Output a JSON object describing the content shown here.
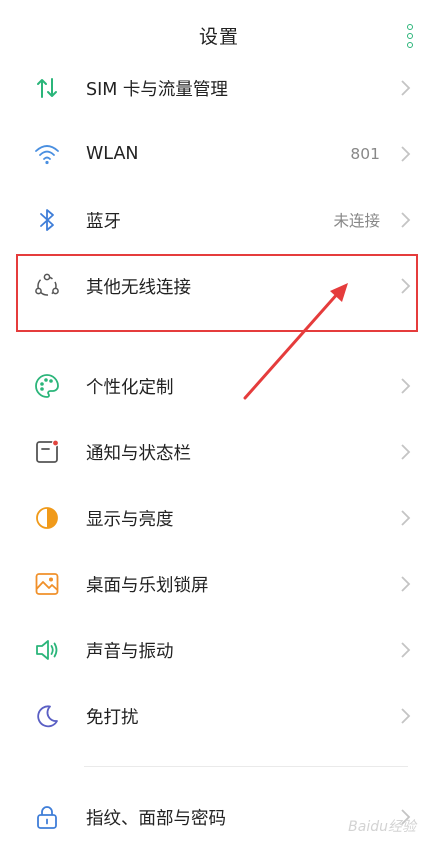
{
  "header": {
    "title": "设置",
    "menu_icon": "more-vertical-icon"
  },
  "items": [
    {
      "label": "SIM 卡与流量管理",
      "value": "",
      "icon": "sim-data-icon"
    },
    {
      "label": "WLAN",
      "value": "801",
      "icon": "wifi-icon"
    },
    {
      "label": "蓝牙",
      "value": "未连接",
      "icon": "bluetooth-icon"
    },
    {
      "label": "其他无线连接",
      "value": "",
      "icon": "wireless-connections-icon"
    },
    {
      "label": "个性化定制",
      "value": "",
      "icon": "palette-icon"
    },
    {
      "label": "通知与状态栏",
      "value": "",
      "icon": "notification-icon"
    },
    {
      "label": "显示与亮度",
      "value": "",
      "icon": "brightness-icon"
    },
    {
      "label": "桌面与乐划锁屏",
      "value": "",
      "icon": "wallpaper-icon"
    },
    {
      "label": "声音与振动",
      "value": "",
      "icon": "speaker-icon"
    },
    {
      "label": "免打扰",
      "value": "",
      "icon": "moon-icon"
    },
    {
      "label": "指纹、面部与密码",
      "value": "",
      "icon": "lock-icon"
    }
  ],
  "watermark": "Baidu经验",
  "colors": {
    "accent": "#2bb57a",
    "highlight": "#e53c3c",
    "chevron": "#c4c4c4"
  }
}
